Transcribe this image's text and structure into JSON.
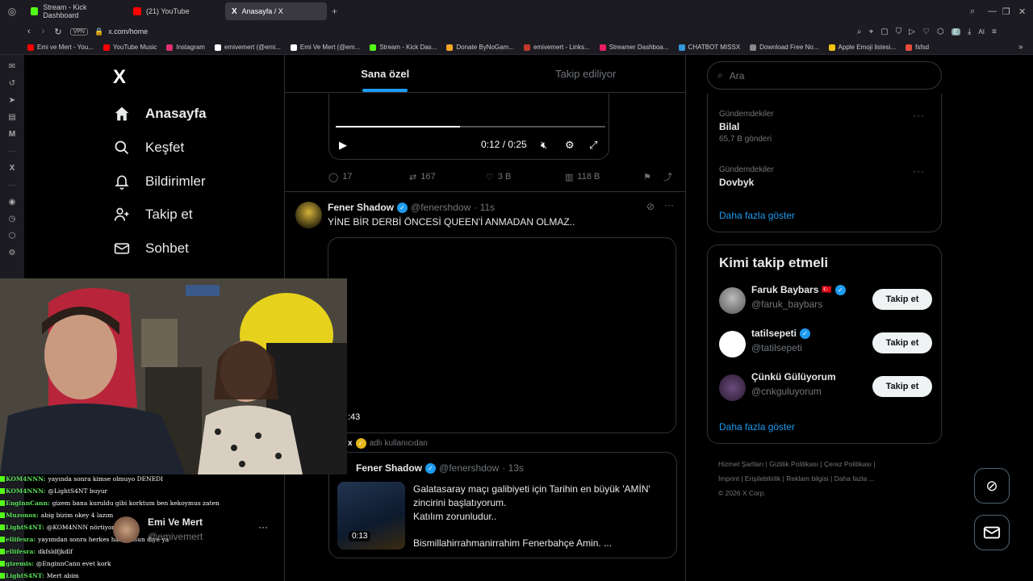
{
  "browser": {
    "tabs": [
      {
        "label": "Stream - Kick Dashboard",
        "color": "#53fc18",
        "active": false
      },
      {
        "label": "(21) YouTube",
        "color": "#ff0000",
        "active": false
      },
      {
        "label": "Anasayfa / X",
        "color": "#ffffff",
        "active": true
      }
    ],
    "vpn": "VPN",
    "url": "x.com/home",
    "ai_label": "AI",
    "profile_initial": "E",
    "bookmarks": [
      {
        "label": "Emi ve Mert - You...",
        "color": "#ff0000"
      },
      {
        "label": "YouTube Music",
        "color": "#ff0000"
      },
      {
        "label": "Instagram",
        "color": "#e1306c"
      },
      {
        "label": "emivemert (@emi...",
        "color": "#ffffff"
      },
      {
        "label": "Emi Ve Mert (@em...",
        "color": "#ffffff"
      },
      {
        "label": "Stream - Kick Das...",
        "color": "#53fc18"
      },
      {
        "label": "Donate ByNoGam...",
        "color": "#f5a623"
      },
      {
        "label": "emivemert - Links...",
        "color": "#c0392b"
      },
      {
        "label": "Streamer Dashboa...",
        "color": "#e91e63"
      },
      {
        "label": "CHATBOT MISSX",
        "color": "#3498db"
      },
      {
        "label": "Download Free No...",
        "color": "#888888"
      },
      {
        "label": "Apple Emoji listesi...",
        "color": "#f1c40f"
      },
      {
        "label": "fsfsd",
        "color": "#e74c3c"
      }
    ]
  },
  "nav": {
    "logo": "X",
    "items": [
      {
        "label": "Anasayfa",
        "icon": "home-icon"
      },
      {
        "label": "Keşfet",
        "icon": "search-icon"
      },
      {
        "label": "Bildirimler",
        "icon": "bell-icon"
      },
      {
        "label": "Takip et",
        "icon": "add-person-icon"
      },
      {
        "label": "Sohbet",
        "icon": "mail-icon"
      }
    ]
  },
  "feed": {
    "tabs": [
      "Sana özel",
      "Takip ediliyor"
    ],
    "video": {
      "time": "0:12 / 0:25",
      "progress_fraction": 0.46
    },
    "actions": {
      "replies": "17",
      "reposts": "167",
      "likes": "3 B",
      "views": "118 B"
    },
    "post1": {
      "name": "Fener Shadow",
      "handle": "@fenershdow",
      "time": "· 11s",
      "text": "YİNE BİR DERBİ ÖNCESİ QUEEN'İ ANMADAN OLMAZ..",
      "media_label": ":43"
    },
    "repost_label": "adlı kullanıcıdan",
    "repost_prefix": "x",
    "post2": {
      "name": "Fener Shadow",
      "handle": "@fenershdow",
      "time": "· 13s",
      "text_line1": "Galatasaray maçı galibiyeti için Tarihin en büyük 'AMİN'",
      "text_line2": "zincirini başlatıyorum.",
      "text_line3": "Katılım zorunludur..",
      "text_line4": "Bismillahirrahmanirrahim Fenerbahçe Amin.  ...",
      "duration": "0:13"
    }
  },
  "right": {
    "search_placeholder": "Ara",
    "trends": [
      {
        "category": "Gündemdekiler",
        "name": "Bilal",
        "count": "65,7 B gönderi"
      },
      {
        "category": "Gündemdekiler",
        "name": "Dovbyk",
        "count": ""
      }
    ],
    "show_more": "Daha fazla göster",
    "wtf_title": "Kimi takip etmeli",
    "follow_label": "Takip et",
    "suggestions": [
      {
        "name": "Faruk Baybars",
        "handle": "@faruk_baybars",
        "flag": "🇹🇷"
      },
      {
        "name": "tatilsepeti",
        "handle": "@tatilsepeti",
        "flag": ""
      },
      {
        "name": "Çünkü Gülüyorum",
        "handle": "@cnkguluyorum",
        "flag": ""
      }
    ],
    "footer": {
      "l1": "Hizmet Şartları  |   Gizlilik Politikası  |   Çerez Politikası  |",
      "l2": "İmprint  |   Erişilebilirlik  |   Reklam bilgisi  |   Daha fazla ...",
      "l3": "© 2026 X Corp."
    }
  },
  "account": {
    "name": "Emi Ve Mert",
    "handle": "@emivemert"
  },
  "chat": [
    {
      "user": "KOM4NNN:",
      "text": "yayında sonra kimse olmuyo DENEDI"
    },
    {
      "user": "KOM4NNN:",
      "text": "@LightS4NT buyur"
    },
    {
      "user": "EnginnCann:",
      "text": "gizem bana kuruldu gibi korktum ben kekoymus zaten"
    },
    {
      "user": "Muzonox:",
      "text": "abig bizim okey 4 lazım"
    },
    {
      "user": "LightS4NT:",
      "text": "@KOM4NNN nörtiyon"
    },
    {
      "user": "ellifesra:",
      "text": "yayımdan sonra herkes hazır olsun diye ya"
    },
    {
      "user": "ellifesra:",
      "text": "dkfsldfjkdlf"
    },
    {
      "user": "gizemis:",
      "text": "@EnginnCann evet kork"
    },
    {
      "user": "LightS4NT:",
      "text": "Mert abim"
    }
  ]
}
